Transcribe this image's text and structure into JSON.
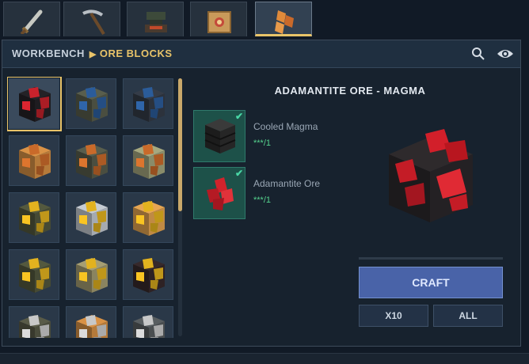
{
  "tabs": [
    {
      "icon": "sword-icon"
    },
    {
      "icon": "pickaxe-icon"
    },
    {
      "icon": "anvil-icon"
    },
    {
      "icon": "crate-icon"
    },
    {
      "icon": "ore-crystal-icon",
      "active": true
    }
  ],
  "breadcrumb": {
    "root": "WORKBENCH",
    "leaf": "ORE BLOCKS"
  },
  "header_icons": [
    "search-icon",
    "eye-icon"
  ],
  "grid": [
    {
      "base": "#1e1c20",
      "ore": "#c8222c",
      "selected": true
    },
    {
      "base": "#4a4e40",
      "ore": "#2b5c9a"
    },
    {
      "base": "#2c323c",
      "ore": "#2b5c9a"
    },
    {
      "base": "#b57a3a",
      "ore": "#c96a2a"
    },
    {
      "base": "#4a4e40",
      "ore": "#c96a2a"
    },
    {
      "base": "#8a8c6a",
      "ore": "#c96a2a"
    },
    {
      "base": "#464a34",
      "ore": "#e2b21f"
    },
    {
      "base": "#a5aab0",
      "ore": "#e2b21f"
    },
    {
      "base": "#c08a44",
      "ore": "#e2b21f"
    },
    {
      "base": "#464a34",
      "ore": "#e2b21f"
    },
    {
      "base": "#8a8460",
      "ore": "#e2b21f"
    },
    {
      "base": "#2e2224",
      "ore": "#e2b21f"
    },
    {
      "base": "#4a4c3c",
      "ore": "#c8c8c8"
    },
    {
      "base": "#b57a3a",
      "ore": "#c8c8c8"
    },
    {
      "base": "#4a4e50",
      "ore": "#c8c8c8"
    }
  ],
  "recipe": {
    "title": "ADAMANTITE ORE - MAGMA",
    "ingredients": [
      {
        "name": "Cooled Magma",
        "qty": "***/1",
        "icon": "cooled-magma-icon"
      },
      {
        "name": "Adamantite Ore",
        "qty": "***/1",
        "icon": "adamantite-ore-icon"
      }
    ]
  },
  "actions": {
    "craft": "CRAFT",
    "x10": "X10",
    "all": "ALL"
  },
  "colors": {
    "accent": "#e9c469",
    "craft": "#4963a8",
    "success": "#55d38e"
  }
}
